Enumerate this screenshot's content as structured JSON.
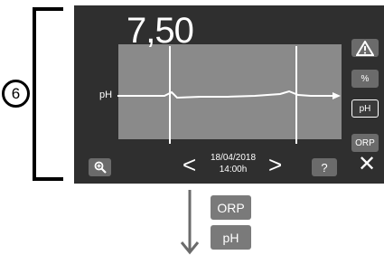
{
  "callout": {
    "number": "6"
  },
  "screen": {
    "reading": "7,50",
    "y_axis_label": "pH",
    "date": "18/04/2018",
    "time": "14:00h",
    "side_buttons": {
      "percent_label": "%",
      "ph_label": "pH",
      "orp_label": "ORP"
    },
    "help_label": "?",
    "close_label": "✕",
    "prev_label": "<",
    "next_label": ">"
  },
  "legend_buttons": {
    "orp_label": "ORP",
    "ph_label": "pH"
  },
  "colors": {
    "screen_bg": "#2f2f2f",
    "plot_bg": "#8a8a8a",
    "button_bg": "#6b6b6b",
    "line": "#ffffff"
  },
  "icons": [
    "warning-icon",
    "zoom-in-icon",
    "close-icon",
    "chevron-left-icon",
    "chevron-right-icon",
    "down-arrow-icon"
  ]
}
